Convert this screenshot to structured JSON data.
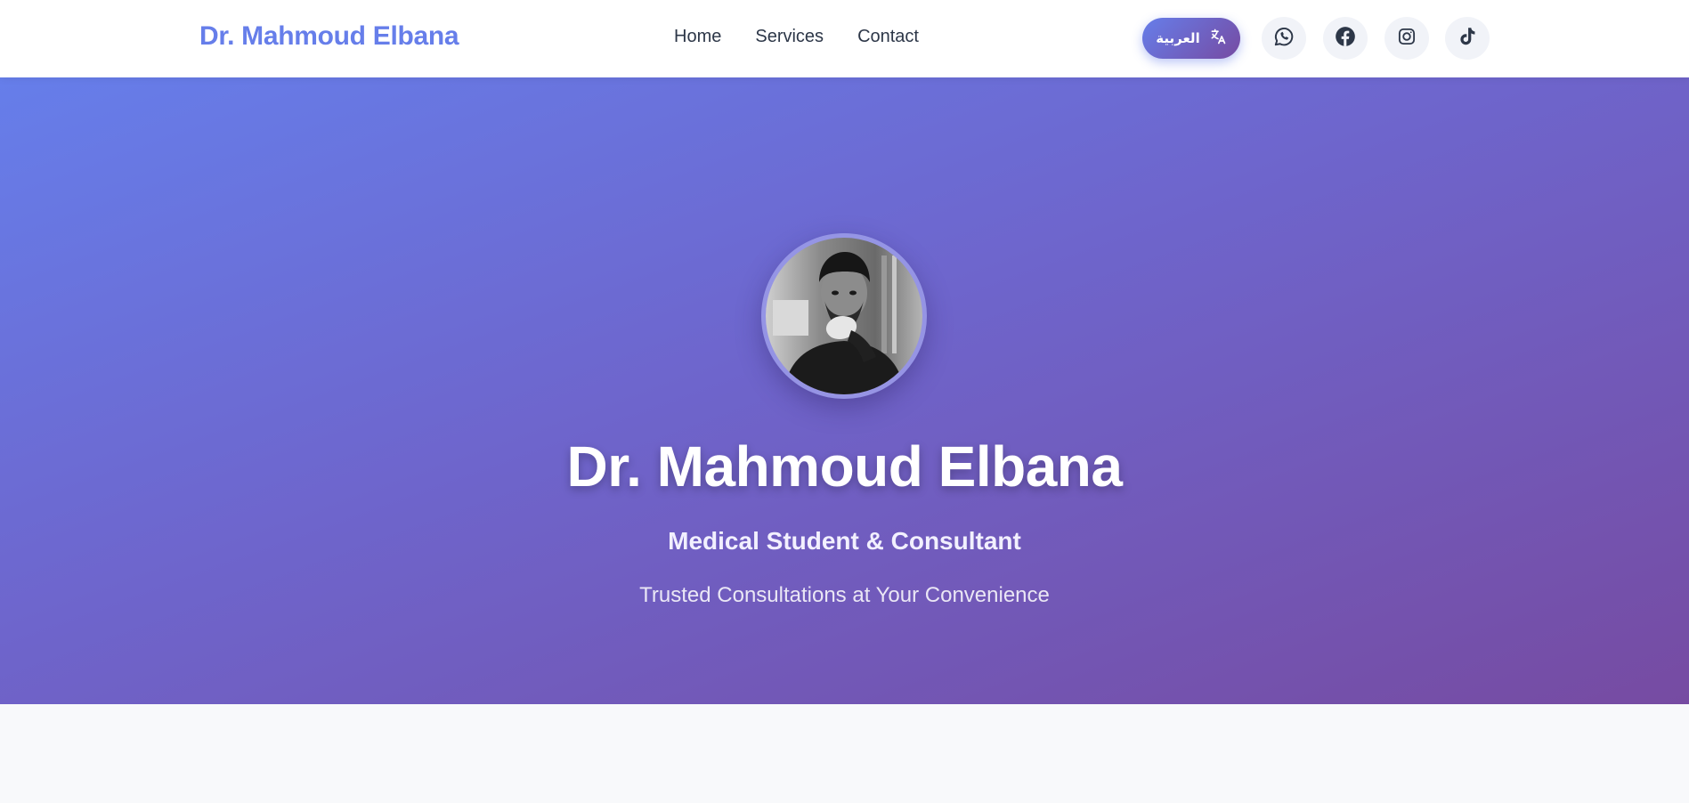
{
  "header": {
    "brand": "Dr. Mahmoud Elbana",
    "nav": [
      {
        "label": "Home"
      },
      {
        "label": "Services"
      },
      {
        "label": "Contact"
      }
    ],
    "language_button": {
      "label": "العربية",
      "icon": "translate-icon"
    },
    "socials": [
      {
        "name": "whatsapp",
        "icon": "whatsapp-icon"
      },
      {
        "name": "facebook",
        "icon": "facebook-icon"
      },
      {
        "name": "instagram",
        "icon": "instagram-icon"
      },
      {
        "name": "tiktok",
        "icon": "tiktok-icon"
      }
    ]
  },
  "hero": {
    "name": "Dr. Mahmoud Elbana",
    "subtitle": "Medical Student & Consultant",
    "tagline": "Trusted Consultations at Your Convenience",
    "avatar": "profile-photo"
  },
  "colors": {
    "brand": "#667eea",
    "gradient_start": "#667eea",
    "gradient_end": "#764ba2",
    "text_dark": "#2d3748",
    "page_bg": "#f8f9fb"
  }
}
